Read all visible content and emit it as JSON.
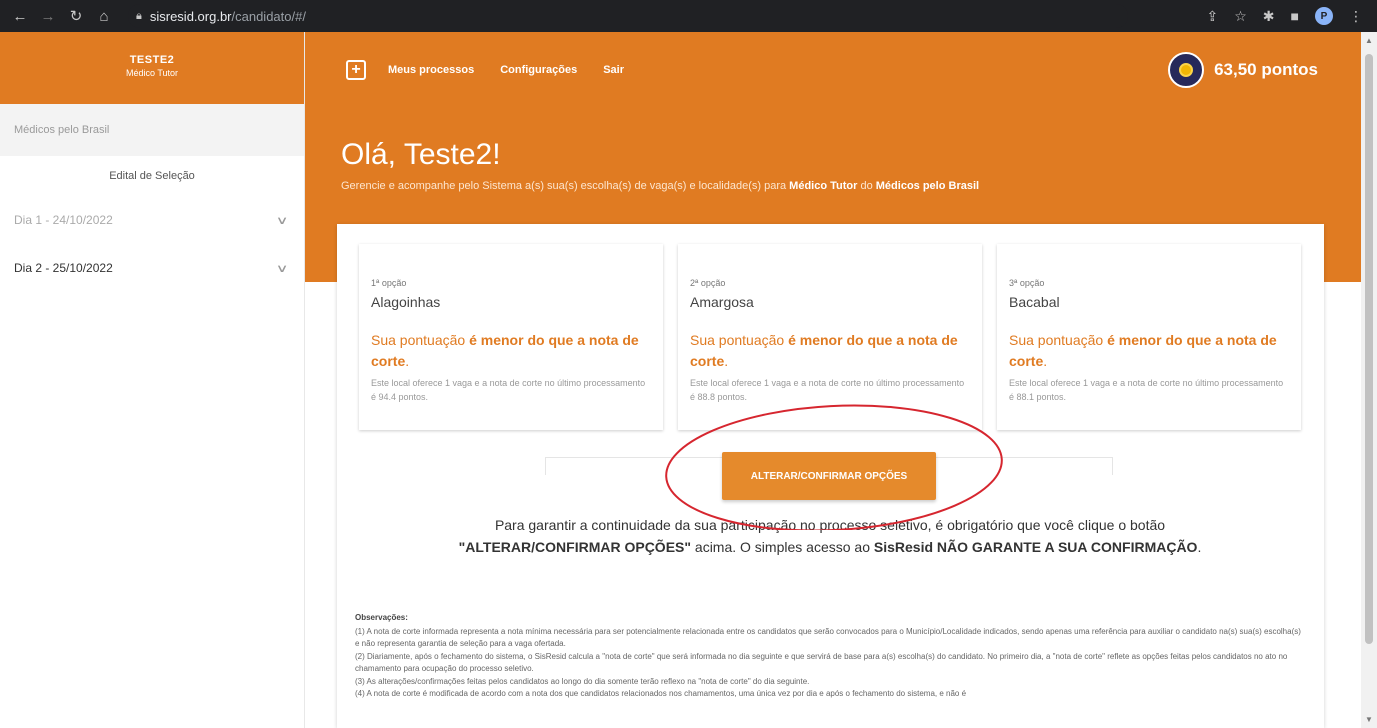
{
  "browser": {
    "url_host": "sisresid.org.br",
    "url_path": "/candidato/#/"
  },
  "sidebar": {
    "user_name": "TESTE2",
    "user_role": "Médico Tutor",
    "program": "Médicos pelo Brasil",
    "edital_link": "Edital de Seleção",
    "days": [
      {
        "label": "Dia 1 - 24/10/2022"
      },
      {
        "label": "Dia 2 - 25/10/2022"
      }
    ]
  },
  "topbar": {
    "menu": [
      "Meus processos",
      "Configurações",
      "Sair"
    ],
    "points": "63,50 pontos"
  },
  "hero": {
    "greeting": "Olá, Teste2!",
    "subtitle_prefix": "Gerencie e acompanhe pelo Sistema a(s) sua(s) escolha(s) de vaga(s) e localidade(s) para ",
    "subtitle_role": "Médico Tutor",
    "subtitle_mid": " do ",
    "subtitle_program": "Médicos pelo Brasil"
  },
  "options": [
    {
      "label": "1ª opção",
      "city": "Alagoinhas",
      "status_prefix": "Sua pontuação ",
      "status_bold": "é menor do que a nota de corte",
      "status_suffix": ".",
      "detail": "Este local oferece 1 vaga e a nota de corte no último processamento é 94.4 pontos."
    },
    {
      "label": "2ª opção",
      "city": "Amargosa",
      "status_prefix": "Sua pontuação ",
      "status_bold": "é menor do que a nota de corte",
      "status_suffix": ".",
      "detail": "Este local oferece 1 vaga e a nota de corte no último processamento é 88.8 pontos."
    },
    {
      "label": "3ª opção",
      "city": "Bacabal",
      "status_prefix": "Sua pontuação ",
      "status_bold": "é menor do que a nota de corte",
      "status_suffix": ".",
      "detail": "Este local oferece 1 vaga e a nota de corte no último processamento é 88.1 pontos."
    }
  ],
  "confirm_button": "ALTERAR/CONFIRMAR OPÇÕES",
  "notice": {
    "part1": "Para garantir a continuidade da sua participação no processo seletivo, é obrigatório que você clique o botão ",
    "button_ref": "\"ALTERAR/CONFIRMAR OPÇÕES\"",
    "part2": " acima. O simples acesso ao ",
    "strong2": "SisResid NÃO GARANTE A SUA CONFIRMAÇÃO",
    "part3": "."
  },
  "observations": {
    "title": "Observações:",
    "items": [
      "(1) A nota de corte informada representa a nota mínima necessária para ser potencialmente relacionada entre os candidatos que serão convocados para o Município/Localidade indicados, sendo apenas uma referência para auxiliar o candidato na(s) sua(s) escolha(s) e não representa garantia de seleção para a vaga ofertada.",
      "(2) Diariamente, após o fechamento do sistema, o SisResid calcula a \"nota de corte\" que será informada no dia seguinte e que servirá de base para a(s) escolha(s) do candidato. No primeiro dia, a \"nota de corte\" reflete as opções feitas pelos candidatos no ato no chamamento para ocupação do processo seletivo.",
      "(3) As alterações/confirmações feitas pelos candidatos ao longo do dia somente terão reflexo na \"nota de corte\" do dia seguinte.",
      "(4) A nota de corte é modificada de acordo com a nota dos que candidatos relacionados nos chamamentos, uma única vez por dia e após o fechamento do sistema, e não é"
    ]
  },
  "colors": {
    "brand_orange": "#e07b22",
    "button_orange": "#e58a2c",
    "annotation_red": "#d6262f"
  }
}
